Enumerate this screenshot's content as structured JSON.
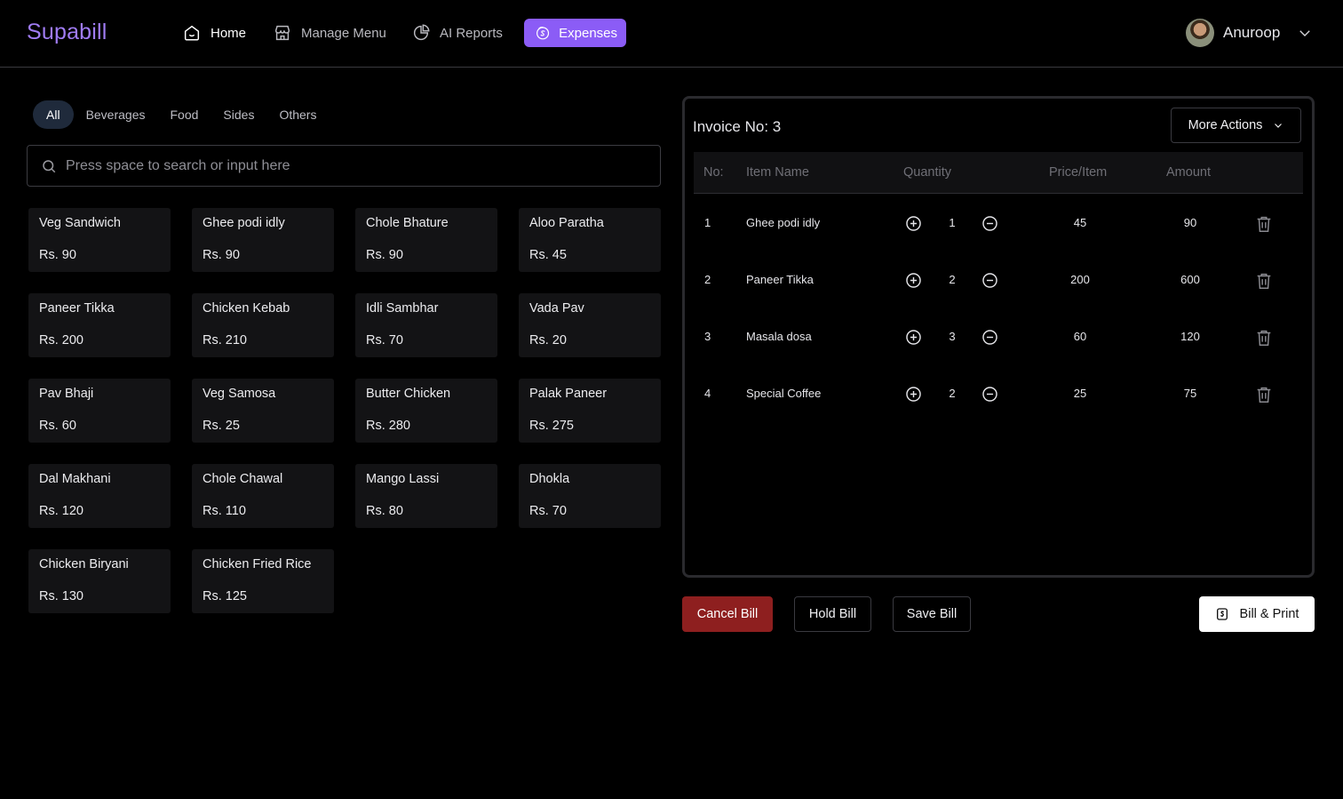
{
  "header": {
    "brand": "Supabill",
    "nav": [
      {
        "label": "Home",
        "icon": "home-icon"
      },
      {
        "label": "Manage Menu",
        "icon": "store-icon"
      },
      {
        "label": "AI Reports",
        "icon": "pie-chart-icon"
      },
      {
        "label": "Expenses",
        "icon": "expenses-icon"
      }
    ],
    "active_nav": "Expenses",
    "user": {
      "name": "Anuroop"
    }
  },
  "filters": {
    "tabs": [
      "All",
      "Beverages",
      "Food",
      "Sides",
      "Others"
    ],
    "active": "All"
  },
  "search": {
    "placeholder": "Press space to search or input here",
    "value": ""
  },
  "menu_items": [
    {
      "name": "Veg Sandwich",
      "price": "Rs. 90"
    },
    {
      "name": "Ghee podi idly",
      "price": "Rs. 90"
    },
    {
      "name": "Chole Bhature",
      "price": "Rs. 90"
    },
    {
      "name": "Aloo Paratha",
      "price": "Rs. 45"
    },
    {
      "name": "Paneer Tikka",
      "price": "Rs. 200"
    },
    {
      "name": "Chicken Kebab",
      "price": "Rs. 210"
    },
    {
      "name": "Idli Sambhar",
      "price": "Rs. 70"
    },
    {
      "name": "Vada Pav",
      "price": "Rs. 20"
    },
    {
      "name": "Pav Bhaji",
      "price": "Rs. 60"
    },
    {
      "name": "Veg Samosa",
      "price": "Rs. 25"
    },
    {
      "name": "Butter Chicken",
      "price": "Rs. 280"
    },
    {
      "name": "Palak Paneer",
      "price": "Rs. 275"
    },
    {
      "name": "Dal Makhani",
      "price": "Rs. 120"
    },
    {
      "name": "Chole Chawal",
      "price": "Rs. 110"
    },
    {
      "name": "Mango Lassi",
      "price": "Rs. 80"
    },
    {
      "name": "Dhokla",
      "price": "Rs. 70"
    },
    {
      "name": "Chicken Biryani",
      "price": "Rs. 130"
    },
    {
      "name": "Chicken Fried Rice",
      "price": "Rs. 125"
    }
  ],
  "invoice": {
    "title": "Invoice No: 3",
    "more_actions": "More Actions",
    "columns": [
      "No:",
      "Item Name",
      "Quantity",
      "Price/Item",
      "Amount"
    ],
    "rows": [
      {
        "no": "1",
        "item": "Ghee podi idly",
        "qty": "1",
        "price": "45",
        "amount": "90"
      },
      {
        "no": "2",
        "item": "Paneer Tikka",
        "qty": "2",
        "price": "200",
        "amount": "600"
      },
      {
        "no": "3",
        "item": "Masala dosa",
        "qty": "3",
        "price": "60",
        "amount": "120"
      },
      {
        "no": "4",
        "item": "Special Coffee",
        "qty": "2",
        "price": "25",
        "amount": "75"
      }
    ]
  },
  "actions": {
    "cancel": "Cancel Bill",
    "hold": "Hold Bill",
    "save": "Save Bill",
    "print": "Bill & Print"
  },
  "colors": {
    "brand": "#a07cf4",
    "active_nav_bg": "#8b5cf6",
    "cancel_bg": "#8e1f1f",
    "card_bg": "#131315"
  }
}
